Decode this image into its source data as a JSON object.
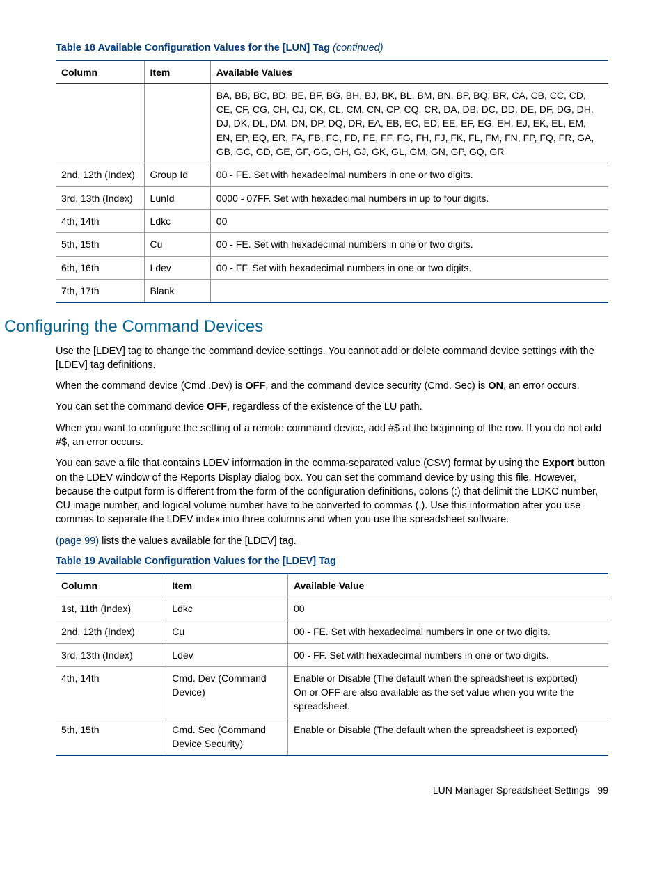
{
  "table18": {
    "title_prefix": "Table 18 Available Configuration Values for the [LUN] Tag ",
    "title_continued": "(continued)",
    "headers": {
      "c1": "Column",
      "c2": "Item",
      "c3": "Available Values"
    },
    "rows": [
      {
        "c1": "",
        "c2": "",
        "c3": "BA, BB, BC, BD, BE, BF, BG, BH, BJ, BK, BL, BM, BN, BP, BQ, BR, CA, CB, CC, CD, CE, CF, CG, CH, CJ, CK, CL, CM, CN, CP, CQ, CR, DA, DB, DC, DD, DE, DF, DG, DH, DJ, DK, DL, DM, DN, DP, DQ, DR, EA, EB, EC, ED, EE, EF, EG, EH, EJ, EK, EL, EM, EN, EP, EQ, ER, FA, FB, FC, FD, FE, FF, FG, FH, FJ, FK, FL, FM, FN, FP, FQ, FR, GA, GB, GC, GD, GE, GF, GG, GH, GJ, GK, GL, GM, GN, GP, GQ, GR"
      },
      {
        "c1": "2nd, 12th (Index)",
        "c2": "Group Id",
        "c3": "00 - FE. Set with hexadecimal numbers in one or two digits."
      },
      {
        "c1": "3rd, 13th (Index)",
        "c2": "LunId",
        "c3": "0000 - 07FF. Set with hexadecimal numbers in up to four digits."
      },
      {
        "c1": "4th, 14th",
        "c2": "Ldkc",
        "c3": "00"
      },
      {
        "c1": "5th, 15th",
        "c2": "Cu",
        "c3": "00 - FE. Set with hexadecimal numbers in one or two digits."
      },
      {
        "c1": "6th, 16th",
        "c2": "Ldev",
        "c3": "00 - FF. Set with hexadecimal numbers in one or two digits."
      },
      {
        "c1": "7th, 17th",
        "c2": "Blank",
        "c3": ""
      }
    ]
  },
  "section": {
    "heading": "Configuring the Command Devices",
    "p1": "Use the [LDEV] tag to change the command device settings. You cannot add or delete command device settings with the [LDEV] tag definitions.",
    "p2a": "When the command device (Cmd .Dev) is ",
    "p2b_bold": "OFF",
    "p2c": ", and the command device security (Cmd. Sec) is ",
    "p2d_bold": "ON",
    "p2e": ", an error occurs.",
    "p3a": "You can set the command device ",
    "p3b_bold": "OFF",
    "p3c": ", regardless of the existence of the LU path.",
    "p4": "When you want to configure the setting of a remote command device, add #$ at the beginning of the row. If you do not add #$, an error occurs.",
    "p5a": "You can save a file that contains LDEV information in the comma-separated value (CSV) format by using the ",
    "p5b_bold": "Export",
    "p5c": " button on the LDEV window of the Reports Display dialog box. You can set the command device by using this file. However, because the output form is different from the form of the configuration definitions, colons (:) that delimit the LDKC number, CU image number, and logical volume number have to be converted to commas (,). Use this information after you use commas to separate the LDEV index into three columns and when you use the spreadsheet software.",
    "p6a": "(page 99)",
    "p6b": " lists the values available for the [LDEV] tag."
  },
  "table19": {
    "title": "Table 19 Available Configuration Values for the [LDEV] Tag",
    "headers": {
      "c1": "Column",
      "c2": "Item",
      "c3": "Available Value"
    },
    "rows": [
      {
        "c1": "1st, 11th (Index)",
        "c2": "Ldkc",
        "c3": "00"
      },
      {
        "c1": "2nd, 12th (Index)",
        "c2": "Cu",
        "c3": "00 - FE. Set with hexadecimal numbers in one or two digits."
      },
      {
        "c1": "3rd, 13th (Index)",
        "c2": "Ldev",
        "c3": "00 - FF. Set with hexadecimal numbers in one or two digits."
      },
      {
        "c1": "4th, 14th",
        "c2": "Cmd. Dev (Command Device)",
        "c3": "Enable or Disable (The default when the spreadsheet is exported)\nOn or OFF are also available as the set value when you write the spreadsheet."
      },
      {
        "c1": "5th, 15th",
        "c2": "Cmd. Sec (Command Device Security)",
        "c3": "Enable or Disable (The default when the spreadsheet is exported)"
      }
    ]
  },
  "footer": {
    "text": "LUN Manager Spreadsheet Settings",
    "page": "99"
  }
}
